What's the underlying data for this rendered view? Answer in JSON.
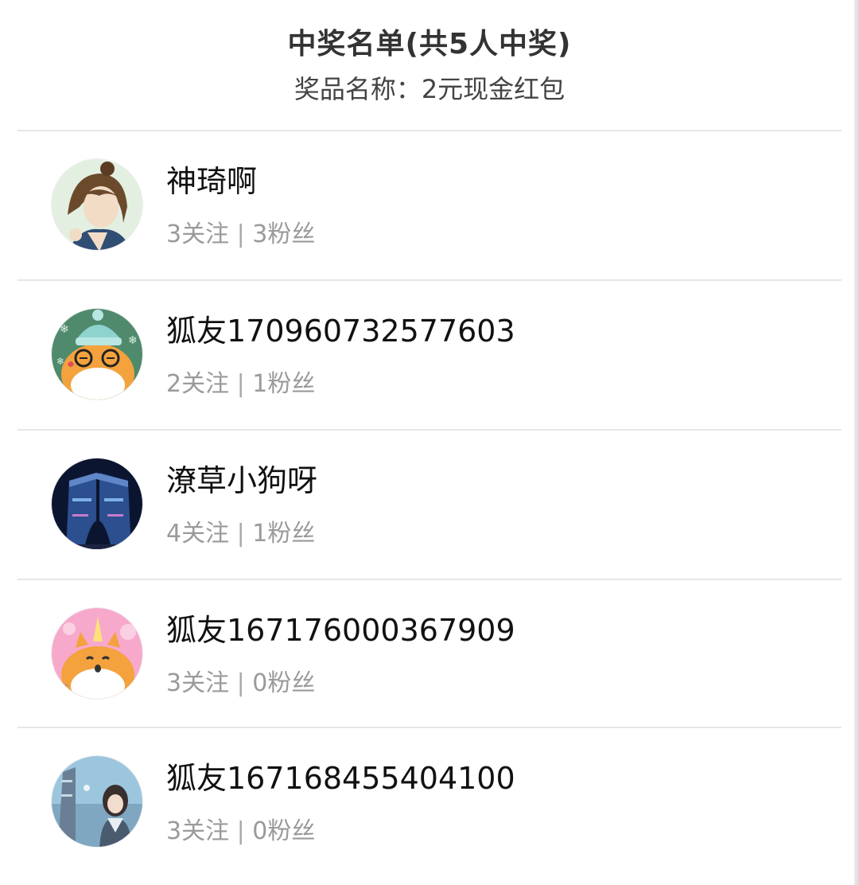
{
  "header": {
    "title": "中奖名单(共5人中奖)",
    "subtitle": "奖品名称：2元现金红包"
  },
  "winners": [
    {
      "name": "神琦啊",
      "following": "3关注",
      "separator": "|",
      "followers": "3粉丝",
      "avatar_icon": "anime-boy-avatar"
    },
    {
      "name": "狐友170960732577603",
      "following": "2关注",
      "separator": "|",
      "followers": "1粉丝",
      "avatar_icon": "cartoon-fox-glasses-avatar"
    },
    {
      "name": "潦草小狗呀",
      "following": "4关注",
      "separator": "|",
      "followers": "1粉丝",
      "avatar_icon": "night-building-avatar"
    },
    {
      "name": "狐友167176000367909",
      "following": "3关注",
      "separator": "|",
      "followers": "0粉丝",
      "avatar_icon": "cartoon-fox-unicorn-avatar"
    },
    {
      "name": "狐友167168455404100",
      "following": "3关注",
      "separator": "|",
      "followers": "0粉丝",
      "avatar_icon": "anime-girl-scenery-avatar"
    }
  ],
  "colors": {
    "title": "#333333",
    "name": "#111111",
    "stats": "#9a9a9a",
    "divider": "#e6e6e6"
  }
}
